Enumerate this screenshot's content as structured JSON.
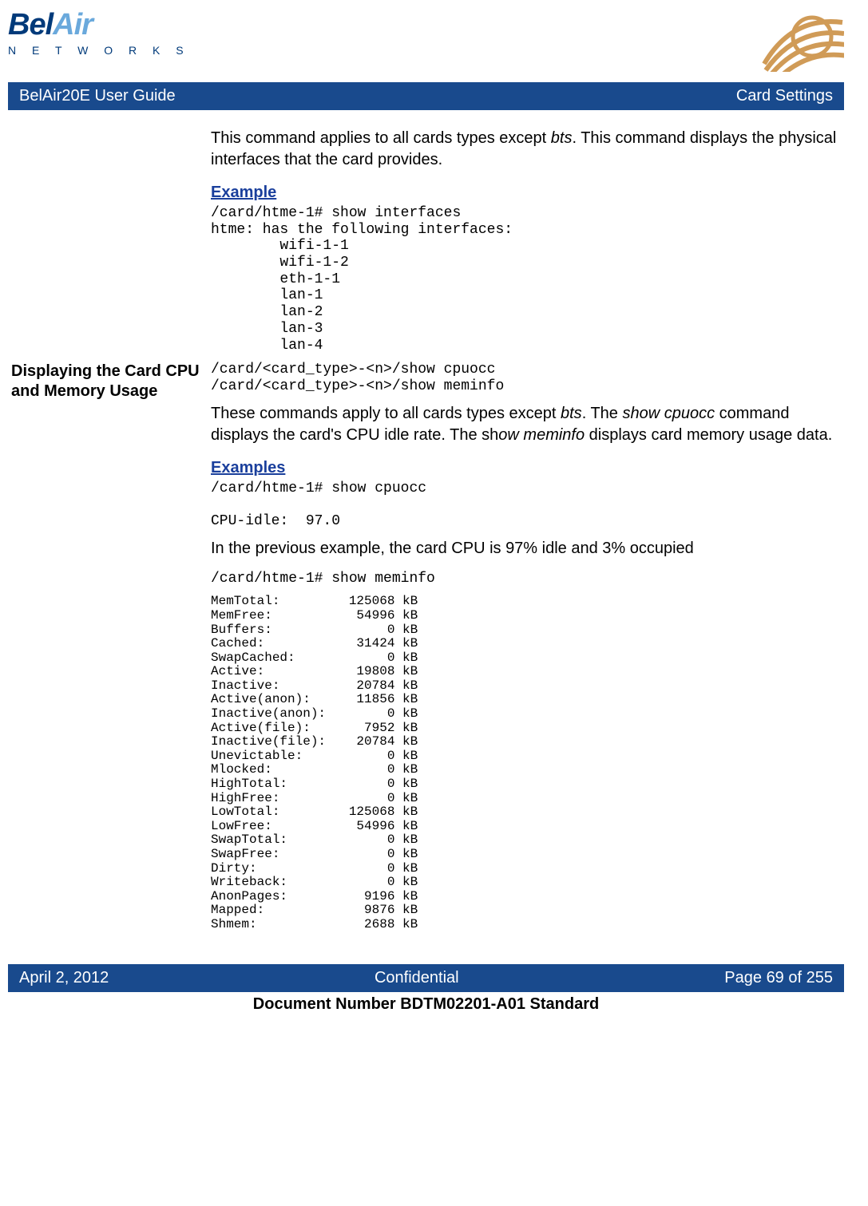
{
  "logo": {
    "part1": "Bel",
    "part2": "Air",
    "sub": "N E T W O R K S"
  },
  "banner": {
    "left": "BelAir20E User Guide",
    "right": "Card Settings"
  },
  "intro": {
    "pre": "This command applies to all cards types except ",
    "bts": "bts",
    "post": ". This command displays the physical interfaces that the card provides."
  },
  "ex1": {
    "hd": "Example",
    "code": "/card/htme-1# show interfaces\nhtme: has the following interfaces:\n        wifi-1-1\n        wifi-1-2\n        eth-1-1\n        lan-1\n        lan-2\n        lan-3\n        lan-4"
  },
  "section2": {
    "heading": "Displaying the Card CPU and Memory Usage",
    "syntax": "/card/<card_type>-<n>/show cpuocc\n/card/<card_type>-<n>/show meminfo",
    "para_pre": "These commands apply to all cards types except ",
    "bts": "bts",
    "para_mid1": ". The ",
    "show_cpuocc": "show cpuocc",
    "para_mid2": " command displays the card's CPU idle rate. The sh",
    "ow_meminfo": "ow meminfo",
    "para_post": " displays card memory usage data."
  },
  "ex2": {
    "hd": "Examples",
    "code1": "/card/htme-1# show cpuocc\n\nCPU-idle:  97.0",
    "para": "In the previous example, the card CPU is 97% idle and 3% occupied",
    "code2": "/card/htme-1# show meminfo",
    "code3": "MemTotal:         125068 kB\nMemFree:           54996 kB\nBuffers:               0 kB\nCached:            31424 kB\nSwapCached:            0 kB\nActive:            19808 kB\nInactive:          20784 kB\nActive(anon):      11856 kB\nInactive(anon):        0 kB\nActive(file):       7952 kB\nInactive(file):    20784 kB\nUnevictable:           0 kB\nMlocked:               0 kB\nHighTotal:             0 kB\nHighFree:              0 kB\nLowTotal:         125068 kB\nLowFree:           54996 kB\nSwapTotal:             0 kB\nSwapFree:              0 kB\nDirty:                 0 kB\nWriteback:             0 kB\nAnonPages:          9196 kB\nMapped:             9876 kB\nShmem:              2688 kB"
  },
  "footer": {
    "left": "April 2, 2012",
    "mid": "Confidential",
    "right": "Page 69 of 255"
  },
  "docnum": "Document Number BDTM02201-A01 Standard"
}
